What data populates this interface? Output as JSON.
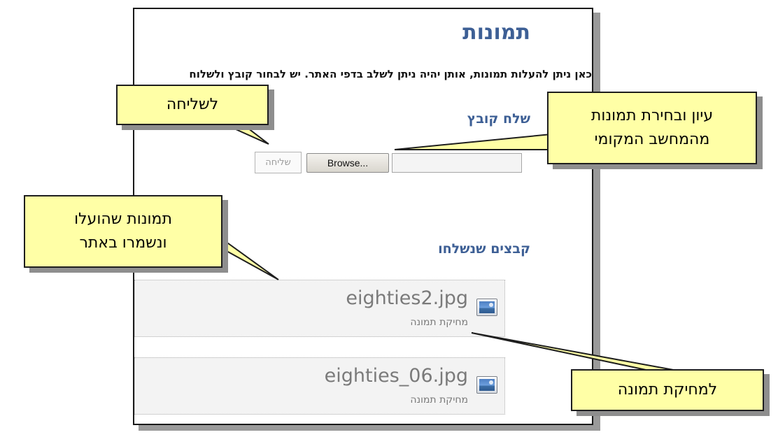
{
  "page": {
    "title": "תמונות",
    "intro": "כאן ניתן להעלות תמונות, אותן יהיה ניתן לשלב בדפי האתר. יש לבחור קובץ ולשלוח",
    "upload_section_title": "שלח קובץ",
    "browse_label": "Browse...",
    "file_input_value": "",
    "send_label": "שליחה",
    "sent_section_title": "קבצים שנשלחו",
    "files": [
      {
        "name": "eighties2.jpg",
        "delete_label": "מחיקת תמונה",
        "icon": "image-icon"
      },
      {
        "name": "eighties_06.jpg",
        "delete_label": "מחיקת תמונה",
        "icon": "image-icon"
      }
    ]
  },
  "callouts": {
    "send": "לשליחה",
    "browse_line1": "עיון ובחירת תמונות",
    "browse_line2": "מהמחשב המקומי",
    "uploaded_line1": "תמונות שהועלו",
    "uploaded_line2": "ונשמרו באתר",
    "delete": "למחיקת תמונה"
  },
  "colors": {
    "heading": "#3d5f95",
    "callout_fill": "#ffffa6",
    "file_card": "#f3f3f3"
  }
}
